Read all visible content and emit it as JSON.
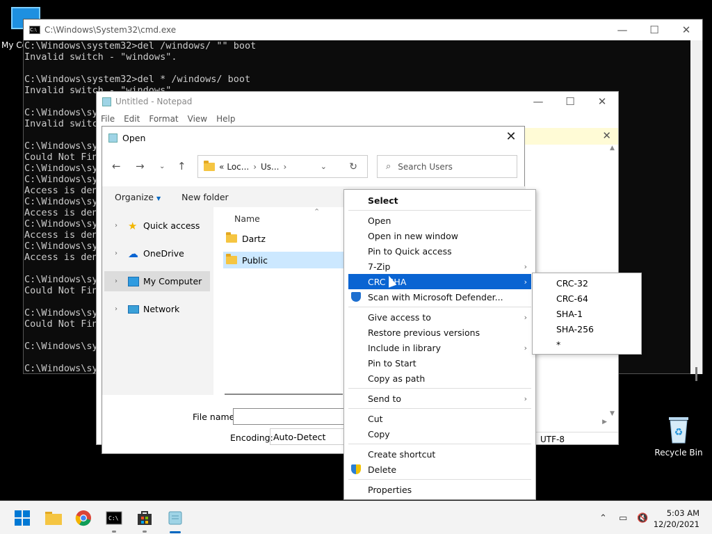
{
  "desktop": {
    "my_computer_label": "My Co",
    "recycle_bin_label": "Recycle Bin"
  },
  "cmd": {
    "title": "C:\\Windows\\System32\\cmd.exe",
    "lines": [
      "C:\\Windows\\system32>del /windows/ \"\" boot",
      "Invalid switch - \"windows\".",
      "",
      "C:\\Windows\\system32>del * /windows/ boot",
      "Invalid switch - \"windows\".",
      "",
      "C:\\Windows\\sy",
      "Invalid switc",
      "",
      "C:\\Windows\\sy",
      "Could Not Fin",
      "C:\\Windows\\sy",
      "C:\\Windows\\sy",
      "Access is den",
      "C:\\Windows\\sy",
      "Access is den",
      "C:\\Windows\\sy",
      "Access is den",
      "C:\\Windows\\sy",
      "Access is den",
      "",
      "C:\\Windows\\sy",
      "Could Not Fin",
      "",
      "C:\\Windows\\sy",
      "Could Not Fin",
      "",
      "C:\\Windows\\sy",
      "",
      "C:\\Windows\\sy"
    ]
  },
  "notepad": {
    "title": "Untitled - Notepad",
    "menu": [
      "File",
      "Edit",
      "Format",
      "View",
      "Help"
    ],
    "status_encoding": "UTF-8"
  },
  "dialog": {
    "title": "Open",
    "address": [
      "«",
      "Loc...",
      "Us..."
    ],
    "search_placeholder": "Search Users",
    "organize_label": "Organize",
    "new_folder_label": "New folder",
    "nav": [
      {
        "label": "Quick access"
      },
      {
        "label": "OneDrive"
      },
      {
        "label": "My Computer"
      },
      {
        "label": "Network"
      }
    ],
    "column_name": "Name",
    "files": [
      {
        "name": "Dartz"
      },
      {
        "name": "Public"
      }
    ],
    "file_name_label": "File name:",
    "encoding_label": "Encoding:",
    "encoding_value": "Auto-Detect"
  },
  "context_menu": {
    "items": [
      {
        "label": "Select"
      },
      {
        "label": "Open"
      },
      {
        "label": "Open in new window"
      },
      {
        "label": "Pin to Quick access"
      },
      {
        "label": "7-Zip"
      },
      {
        "label": "CRC SHA"
      },
      {
        "label": "Scan with Microsoft Defender..."
      },
      {
        "label": "Give access to"
      },
      {
        "label": "Restore previous versions"
      },
      {
        "label": "Include in library"
      },
      {
        "label": "Pin to Start"
      },
      {
        "label": "Copy as path"
      },
      {
        "label": "Send to"
      },
      {
        "label": "Cut"
      },
      {
        "label": "Copy"
      },
      {
        "label": "Create shortcut"
      },
      {
        "label": "Delete"
      },
      {
        "label": "Properties"
      }
    ],
    "submenu": [
      "CRC-32",
      "CRC-64",
      "SHA-1",
      "SHA-256",
      "*"
    ]
  },
  "taskbar": {
    "time": "5:03 AM",
    "date": "12/20/2021"
  },
  "colors": {
    "highlight": "#0a64d2",
    "accent": "#0067c0"
  }
}
